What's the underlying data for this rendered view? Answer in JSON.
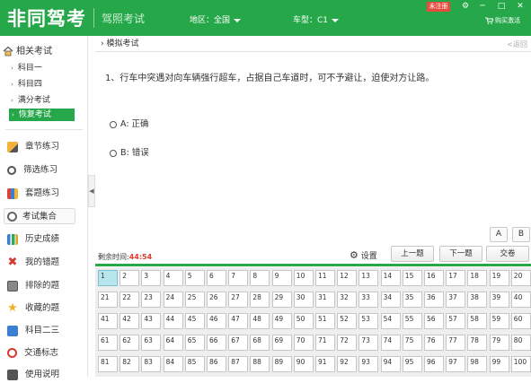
{
  "app": {
    "brand": "非同驾考",
    "subtitle": "驾照考试",
    "region_label": "地区：全国",
    "cartype_label": "车型：C1",
    "unregistered": "未注册",
    "buy_activate": "购买激活",
    "accent": "#26a84a"
  },
  "sidebar": {
    "section_title": "相关考试",
    "sub_items": [
      "科目一",
      "科目四",
      "满分考试",
      "恢复考试"
    ],
    "active_sub": "恢复考试",
    "nav": [
      {
        "label": "章节练习",
        "icon": "pencil-icon"
      },
      {
        "label": "筛选练习",
        "icon": "magnifier-icon"
      },
      {
        "label": "套题练习",
        "icon": "books-icon"
      },
      {
        "label": "考试集合",
        "icon": "clock-icon"
      },
      {
        "label": "历史成绩",
        "icon": "bar-chart-icon"
      },
      {
        "label": "我的错题",
        "icon": "cross-icon"
      },
      {
        "label": "排除的题",
        "icon": "clipboard-icon"
      },
      {
        "label": "收藏的题",
        "icon": "star-icon"
      },
      {
        "label": "科目二三",
        "icon": "document-icon"
      },
      {
        "label": "交通标志",
        "icon": "traffic-sign-icon"
      },
      {
        "label": "使用说明",
        "icon": "help-icon"
      }
    ],
    "active_nav": "考试集合"
  },
  "breadcrumb": {
    "title": "模拟考试",
    "back": "<返回"
  },
  "question": {
    "text": "1、行车中突遇对向车辆强行超车，占据自己车道时，可不予避让，迫使对方让路。",
    "options": [
      "A: 正确",
      "B: 错误"
    ]
  },
  "answer_buttons": [
    "A",
    "B"
  ],
  "timer": {
    "label": "剩余时间:",
    "value": "44:54"
  },
  "controls": {
    "settings": "设置",
    "prev": "上一题",
    "next": "下一题",
    "submit": "交卷"
  },
  "grid": {
    "current": 1,
    "numbers": [
      1,
      2,
      3,
      4,
      5,
      6,
      7,
      8,
      9,
      10,
      11,
      12,
      13,
      14,
      15,
      16,
      17,
      18,
      19,
      20,
      21,
      22,
      23,
      24,
      25,
      26,
      27,
      28,
      29,
      30,
      31,
      32,
      33,
      34,
      35,
      36,
      37,
      38,
      39,
      40,
      41,
      42,
      43,
      44,
      45,
      46,
      47,
      48,
      49,
      50,
      51,
      52,
      53,
      54,
      55,
      56,
      57,
      58,
      59,
      60,
      61,
      62,
      63,
      64,
      65,
      66,
      67,
      68,
      69,
      70,
      71,
      72,
      73,
      74,
      75,
      76,
      77,
      78,
      79,
      80,
      81,
      82,
      83,
      84,
      85,
      86,
      87,
      88,
      89,
      90,
      91,
      92,
      93,
      94,
      95,
      96,
      97,
      98,
      99,
      100
    ]
  }
}
